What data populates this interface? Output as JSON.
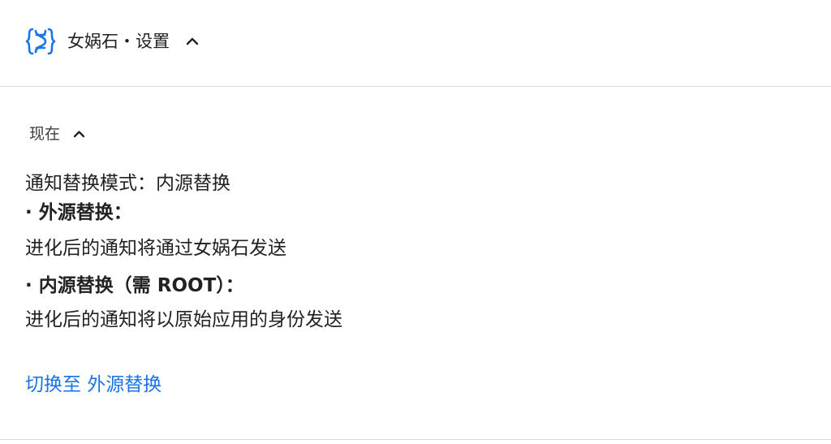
{
  "header": {
    "icon": "dna-braces-icon",
    "title": "女娲石・设置",
    "accent_color": "#1a73e8"
  },
  "section": {
    "time_label": "现在",
    "mode_line": "通知替换模式：内源替换",
    "outer_heading": "· 外源替换：",
    "outer_desc": "进化后的通知将通过女娲石发送",
    "inner_heading": "· 内源替换（需 ROOT）：",
    "inner_desc": "进化后的通知将以原始应用的身份发送",
    "action_label": "切换至 外源替换",
    "action_color": "#1a73e8"
  }
}
